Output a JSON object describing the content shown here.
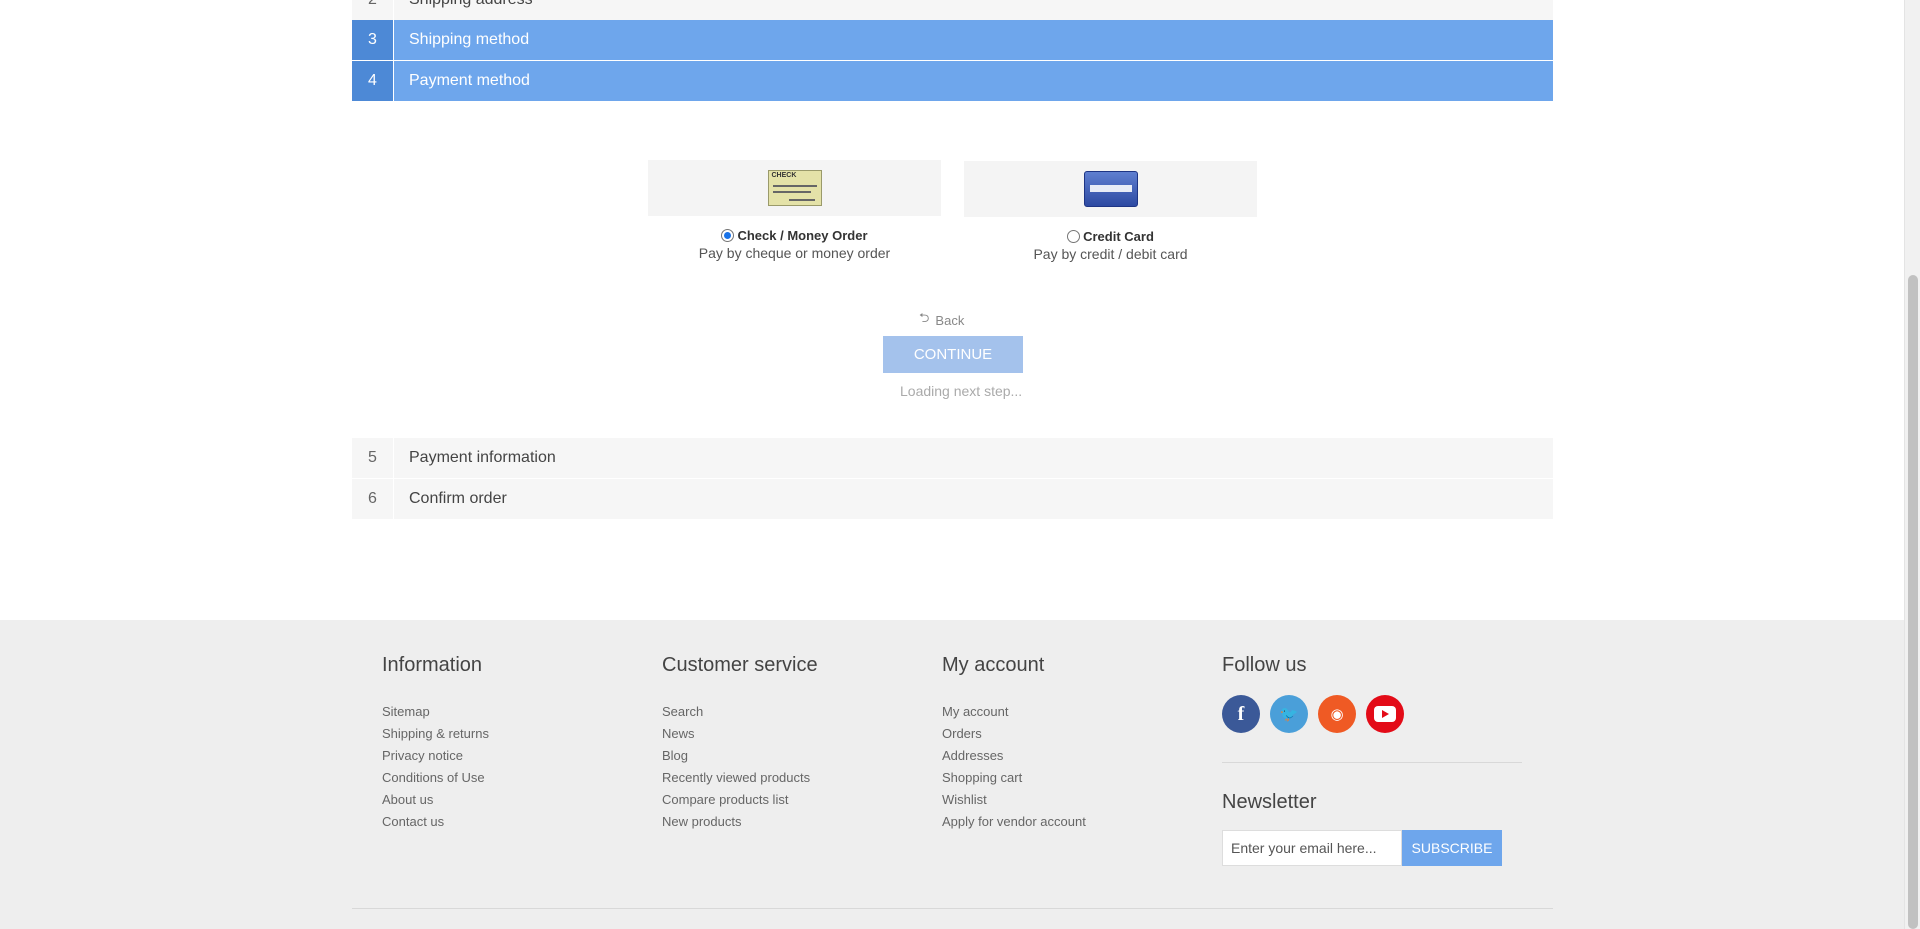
{
  "steps": [
    {
      "num": "2",
      "title": "Shipping address",
      "state": "inactive"
    },
    {
      "num": "3",
      "title": "Shipping method",
      "state": "active"
    },
    {
      "num": "4",
      "title": "Payment method",
      "state": "active"
    },
    {
      "num": "5",
      "title": "Payment information",
      "state": "inactive"
    },
    {
      "num": "6",
      "title": "Confirm order",
      "state": "inactive"
    }
  ],
  "payment_methods": [
    {
      "name": "Check / Money Order",
      "description": "Pay by cheque or money order",
      "selected": true,
      "image_icon": "check-image-icon",
      "image_text": "CHECK"
    },
    {
      "name": "Credit Card",
      "description": "Pay by credit / debit card",
      "selected": false,
      "image_icon": "credit-card-image-icon"
    }
  ],
  "actions": {
    "back_label": "Back",
    "continue_label": "CONTINUE",
    "loading_text": "Loading next step..."
  },
  "footer": {
    "information": {
      "title": "Information",
      "links": [
        "Sitemap",
        "Shipping & returns",
        "Privacy notice",
        "Conditions of Use",
        "About us",
        "Contact us"
      ]
    },
    "customer_service": {
      "title": "Customer service",
      "links": [
        "Search",
        "News",
        "Blog",
        "Recently viewed products",
        "Compare products list",
        "New products"
      ]
    },
    "my_account": {
      "title": "My account",
      "links": [
        "My account",
        "Orders",
        "Addresses",
        "Shopping cart",
        "Wishlist",
        "Apply for vendor account"
      ]
    },
    "follow_us": {
      "title": "Follow us",
      "icons": [
        "facebook-icon",
        "twitter-icon",
        "rss-icon",
        "youtube-icon"
      ]
    },
    "newsletter": {
      "title": "Newsletter",
      "placeholder": "Enter your email here...",
      "button_label": "SUBSCRIBE"
    }
  },
  "colors": {
    "accent": "#6ea6ec",
    "accent_dark": "#4d89d6",
    "continue_disabled": "#a4c2ec"
  }
}
